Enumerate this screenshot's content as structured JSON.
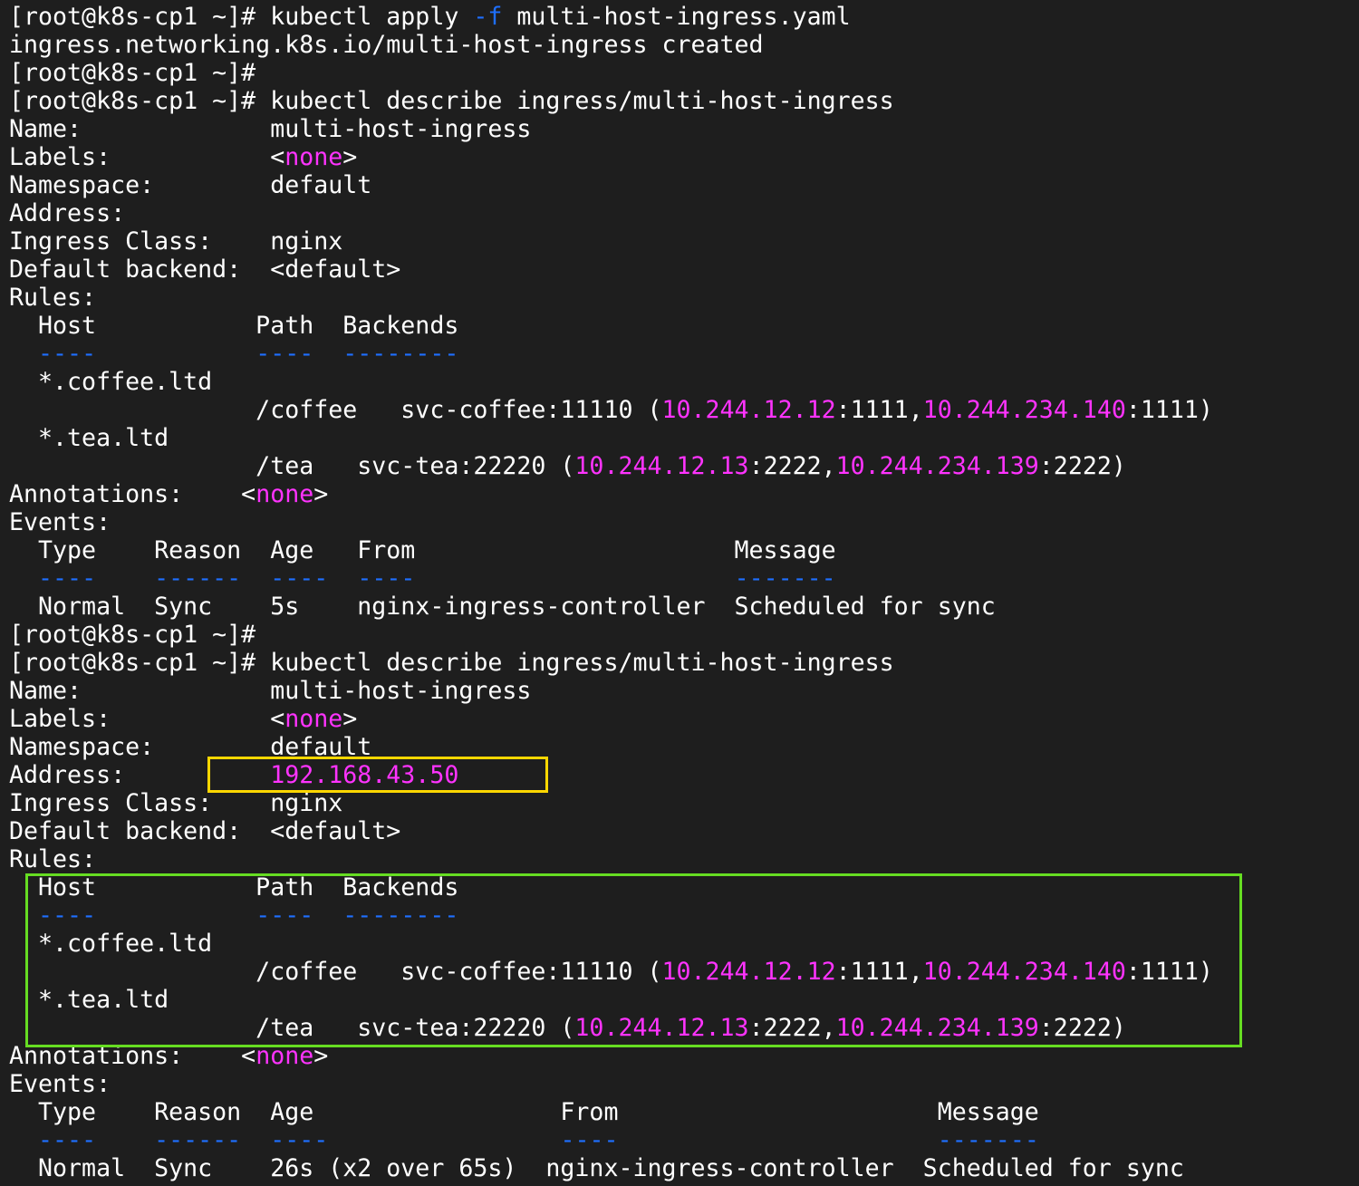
{
  "colors": {
    "background": "#1e1e1e",
    "text": "#ffffff",
    "magenta": "#ff33ff",
    "blue": "#1e6fff",
    "highlight_yellow": "#ffd700",
    "highlight_green": "#66dd22"
  },
  "terminal": {
    "lines": [
      [
        {
          "t": "[root@k8s-cp1 ~]# kubectl apply "
        },
        {
          "t": "-f",
          "c": "blue"
        },
        {
          "t": " multi-host-ingress.yaml"
        }
      ],
      [
        {
          "t": "ingress.networking.k8s.io/multi-host-ingress created"
        }
      ],
      [
        {
          "t": "[root@k8s-cp1 ~]#"
        }
      ],
      [
        {
          "t": "[root@k8s-cp1 ~]# kubectl describe ingress/multi-host-ingress"
        }
      ],
      [
        {
          "t": "Name:             multi-host-ingress"
        }
      ],
      [
        {
          "t": "Labels:           <"
        },
        {
          "t": "none",
          "c": "magenta"
        },
        {
          "t": ">"
        }
      ],
      [
        {
          "t": "Namespace:        default"
        }
      ],
      [
        {
          "t": "Address:"
        }
      ],
      [
        {
          "t": "Ingress Class:    nginx"
        }
      ],
      [
        {
          "t": "Default backend:  <default>"
        }
      ],
      [
        {
          "t": "Rules:"
        }
      ],
      [
        {
          "t": "  Host           Path  Backends"
        }
      ],
      [
        {
          "t": "  "
        },
        {
          "t": "----",
          "c": "blue"
        },
        {
          "t": "           "
        },
        {
          "t": "----",
          "c": "blue"
        },
        {
          "t": "  "
        },
        {
          "t": "--------",
          "c": "blue"
        }
      ],
      [
        {
          "t": "  *.coffee.ltd"
        }
      ],
      [
        {
          "t": "                 /coffee   svc-coffee:11110 ("
        },
        {
          "t": "10.244.12.12",
          "c": "magenta"
        },
        {
          "t": ":1111,"
        },
        {
          "t": "10.244.234.140",
          "c": "magenta"
        },
        {
          "t": ":1111)"
        }
      ],
      [
        {
          "t": "  *.tea.ltd"
        }
      ],
      [
        {
          "t": "                 /tea   svc-tea:22220 ("
        },
        {
          "t": "10.244.12.13",
          "c": "magenta"
        },
        {
          "t": ":2222,"
        },
        {
          "t": "10.244.234.139",
          "c": "magenta"
        },
        {
          "t": ":2222)"
        }
      ],
      [
        {
          "t": "Annotations:    <"
        },
        {
          "t": "none",
          "c": "magenta"
        },
        {
          "t": ">"
        }
      ],
      [
        {
          "t": "Events:"
        }
      ],
      [
        {
          "t": "  Type    Reason  Age   From                      Message"
        }
      ],
      [
        {
          "t": "  "
        },
        {
          "t": "----",
          "c": "blue"
        },
        {
          "t": "    "
        },
        {
          "t": "------",
          "c": "blue"
        },
        {
          "t": "  "
        },
        {
          "t": "----",
          "c": "blue"
        },
        {
          "t": "  "
        },
        {
          "t": "----",
          "c": "blue"
        },
        {
          "t": "                      "
        },
        {
          "t": "-------",
          "c": "blue"
        }
      ],
      [
        {
          "t": "  Normal  Sync    5s    nginx-ingress-controller  Scheduled for sync"
        }
      ],
      [
        {
          "t": "[root@k8s-cp1 ~]#"
        }
      ],
      [
        {
          "t": "[root@k8s-cp1 ~]# kubectl describe ingress/multi-host-ingress"
        }
      ],
      [
        {
          "t": "Name:             multi-host-ingress"
        }
      ],
      [
        {
          "t": "Labels:           <"
        },
        {
          "t": "none",
          "c": "magenta"
        },
        {
          "t": ">"
        }
      ],
      [
        {
          "t": "Namespace:        default"
        }
      ],
      [
        {
          "t": "Address:          "
        },
        {
          "t": "192.168.43.50",
          "c": "magenta"
        }
      ],
      [
        {
          "t": "Ingress Class:    nginx"
        }
      ],
      [
        {
          "t": "Default backend:  <default>"
        }
      ],
      [
        {
          "t": "Rules:"
        }
      ],
      [
        {
          "t": "  Host           Path  Backends"
        }
      ],
      [
        {
          "t": "  "
        },
        {
          "t": "----",
          "c": "blue"
        },
        {
          "t": "           "
        },
        {
          "t": "----",
          "c": "blue"
        },
        {
          "t": "  "
        },
        {
          "t": "--------",
          "c": "blue"
        }
      ],
      [
        {
          "t": "  *.coffee.ltd"
        }
      ],
      [
        {
          "t": "                 /coffee   svc-coffee:11110 ("
        },
        {
          "t": "10.244.12.12",
          "c": "magenta"
        },
        {
          "t": ":1111,"
        },
        {
          "t": "10.244.234.140",
          "c": "magenta"
        },
        {
          "t": ":1111)"
        }
      ],
      [
        {
          "t": "  *.tea.ltd"
        }
      ],
      [
        {
          "t": "                 /tea   svc-tea:22220 ("
        },
        {
          "t": "10.244.12.13",
          "c": "magenta"
        },
        {
          "t": ":2222,"
        },
        {
          "t": "10.244.234.139",
          "c": "magenta"
        },
        {
          "t": ":2222)"
        }
      ],
      [
        {
          "t": "Annotations:    <"
        },
        {
          "t": "none",
          "c": "magenta"
        },
        {
          "t": ">"
        }
      ],
      [
        {
          "t": "Events:"
        }
      ],
      [
        {
          "t": "  Type    Reason  Age                 From                      Message"
        }
      ],
      [
        {
          "t": "  "
        },
        {
          "t": "----",
          "c": "blue"
        },
        {
          "t": "    "
        },
        {
          "t": "------",
          "c": "blue"
        },
        {
          "t": "  "
        },
        {
          "t": "----",
          "c": "blue"
        },
        {
          "t": "                "
        },
        {
          "t": "----",
          "c": "blue"
        },
        {
          "t": "                      "
        },
        {
          "t": "-------",
          "c": "blue"
        }
      ],
      [
        {
          "t": "  Normal  Sync    26s (x2 over 65s)  nginx-ingress-controller  Scheduled for sync"
        }
      ]
    ]
  }
}
